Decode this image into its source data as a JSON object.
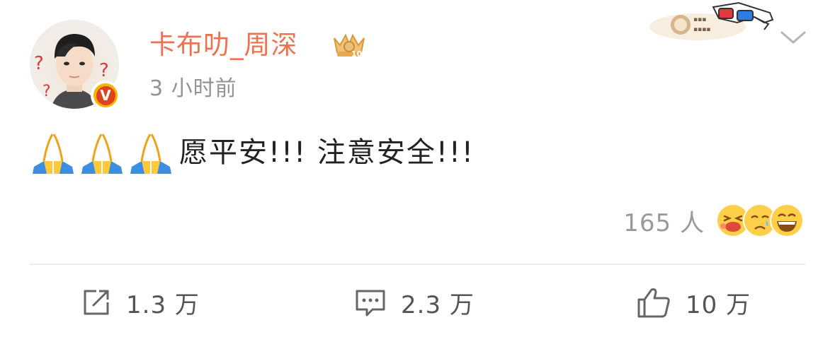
{
  "post": {
    "username": "卡布叻_周深",
    "timestamp": "3 小时前",
    "text": "愿平安!!! 注意安全!!!",
    "emojis": [
      "folded-hands",
      "folded-hands",
      "folded-hands"
    ],
    "verified_badge": "V"
  },
  "likes": {
    "count_label": "165 人",
    "reactions": [
      "kiss-emoji",
      "tearful-emoji",
      "laugh-emoji"
    ]
  },
  "actions": {
    "repost": {
      "icon": "share-icon",
      "count": "1.3 万"
    },
    "comment": {
      "icon": "comment-icon",
      "count": "2.3 万"
    },
    "like": {
      "icon": "thumbs-up-icon",
      "count": "10 万"
    }
  },
  "colors": {
    "username": "#eb7350",
    "timestamp": "#939393",
    "text": "#222222",
    "secondary": "#999999",
    "verified_outer": "#f6b400",
    "verified_inner": "#e0431c"
  }
}
